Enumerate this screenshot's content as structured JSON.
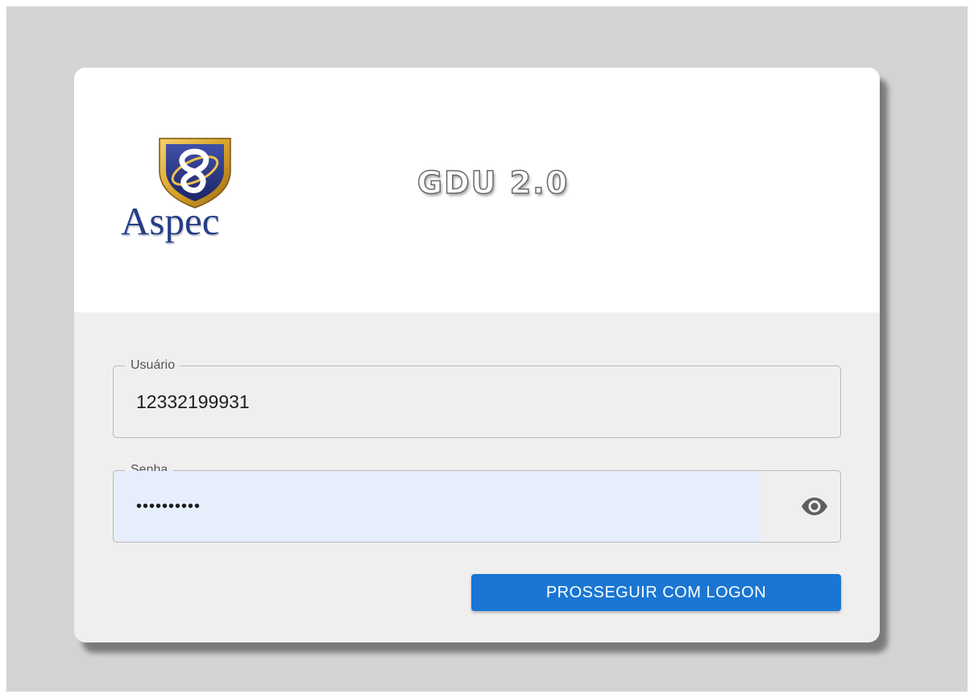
{
  "brand": {
    "logo_text": "Aspec",
    "app_title": "GDU 2.0"
  },
  "login_form": {
    "username": {
      "label": "Usuário",
      "value": "12332199931"
    },
    "password": {
      "label": "Senha",
      "value": "••••••••••",
      "toggle_icon": "eye-icon"
    },
    "submit_label": "PROSSEGUIR COM LOGON"
  },
  "colors": {
    "accent": "#1a76d2",
    "logo_blue": "#263e87",
    "shield_gold": "#d9a22a",
    "autofill_bg": "#e6eefb",
    "page_bg": "#d3d3d3"
  }
}
